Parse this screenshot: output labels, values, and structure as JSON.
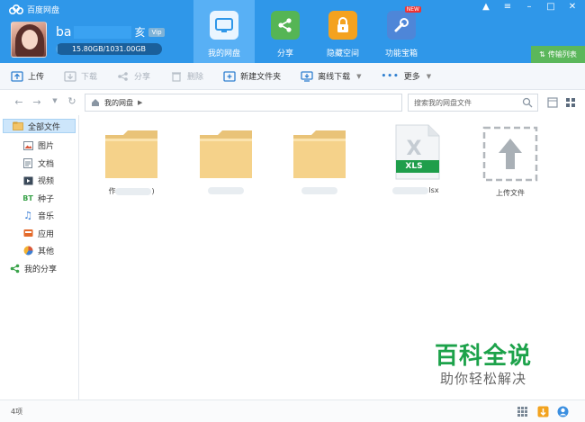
{
  "window": {
    "app_title": "百度网盘",
    "controls": [
      "bell-icon",
      "menu-icon",
      "minimize-icon",
      "maximize-icon",
      "close-icon"
    ]
  },
  "user": {
    "name_prefix": "ba",
    "name_suffix": "亥",
    "vip_label": "Vip",
    "quota_text": "15.80GB/1031.00GB",
    "quota_fraction": 0.015
  },
  "nav": {
    "tabs": [
      {
        "label": "我的网盘",
        "icon": "cloud-drive-icon",
        "active": true
      },
      {
        "label": "分享",
        "icon": "share-icon",
        "active": false
      },
      {
        "label": "隐藏空间",
        "icon": "lock-icon",
        "active": false
      },
      {
        "label": "功能宝箱",
        "icon": "toolbox-icon",
        "active": false,
        "badge": "NEW"
      }
    ],
    "transfer_list": "传输列表"
  },
  "toolbar": {
    "upload": "上传",
    "download": "下载",
    "share": "分享",
    "delete": "删除",
    "new_folder": "新建文件夹",
    "offline_download": "离线下载",
    "more": "更多"
  },
  "address": {
    "path_root": "我的网盘",
    "search_placeholder": "搜索我的网盘文件"
  },
  "sidebar": {
    "root": "全部文件",
    "items": [
      {
        "label": "图片",
        "icon": "image-icon"
      },
      {
        "label": "文档",
        "icon": "document-icon"
      },
      {
        "label": "视频",
        "icon": "video-icon"
      },
      {
        "label": "种子",
        "icon": "bt-icon"
      },
      {
        "label": "音乐",
        "icon": "music-icon"
      },
      {
        "label": "应用",
        "icon": "app-icon"
      },
      {
        "label": "其他",
        "icon": "other-icon"
      }
    ],
    "my_share": "我的分享"
  },
  "files": [
    {
      "type": "folder",
      "name_visible": "作",
      "name_visible_end": ")"
    },
    {
      "type": "folder",
      "name_visible": "",
      "name_visible_end": ""
    },
    {
      "type": "folder",
      "name_visible": "",
      "name_visible_end": ""
    },
    {
      "type": "xls",
      "name_visible": "",
      "name_visible_end": "lsx",
      "badge": "XLS"
    },
    {
      "type": "upload",
      "name_visible": "上传文件"
    }
  ],
  "watermark": {
    "title": "百科全说",
    "subtitle": "助你轻松解决"
  },
  "status": {
    "count": "4项"
  },
  "colors": {
    "header_blue": "#2f97e9",
    "active_tab": "#58b0f5",
    "transfer_green": "#5bb75b",
    "folder_yellow": "#f5d28a",
    "xls_green": "#1f9e4b",
    "watermark_green": "#1ca24a"
  }
}
